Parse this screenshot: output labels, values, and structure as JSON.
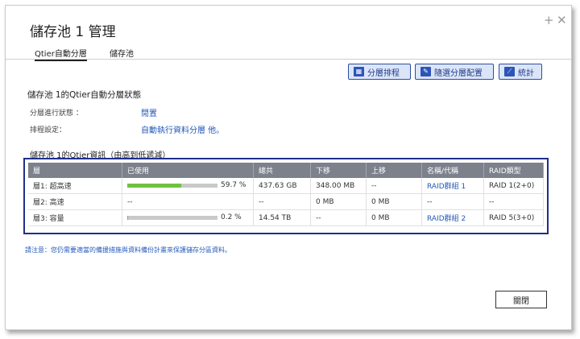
{
  "window": {
    "title": "儲存池 1 管理",
    "plus_icon": "+",
    "close_icon": "✕"
  },
  "tabs": [
    {
      "label": "Qtier自動分層"
    },
    {
      "label": "儲存池"
    }
  ],
  "toolbar": {
    "schedule_label": "分層排程",
    "config_label": "隨選分層配置",
    "stats_label": "統計"
  },
  "status_section": {
    "title": "儲存池 1的Qtier自動分層狀態",
    "progress_label": "分層進行狀態 ：",
    "progress_value": "閒置",
    "schedule_label": "排程設定：",
    "schedule_value": "自動執行資料分層 他。"
  },
  "table_section": {
    "title": "儲存池 1的Qtier資訊（由高到低遞減）",
    "headers": [
      "層",
      "已使用",
      "總共",
      "下移",
      "上移",
      "名稱/代稱",
      "RAID類型"
    ],
    "rows": [
      {
        "tier": "層1: 超高速",
        "used_pct": "59.7 %",
        "used_fraction": 0.597,
        "total": "437.63 GB",
        "down": "348.00 MB",
        "up": "--",
        "name": "RAID群組 1",
        "raid": "RAID 1(2+0)"
      },
      {
        "tier": "層2: 高速",
        "used_pct": "--",
        "used_fraction": null,
        "total": "--",
        "down": "0 MB",
        "up": "0 MB",
        "name": "--",
        "raid": "--"
      },
      {
        "tier": "層3: 容量",
        "used_pct": "0.2 %",
        "used_fraction": 0.002,
        "total": "14.54 TB",
        "down": "--",
        "up": "0 MB",
        "name": "RAID群組 2",
        "raid": "RAID 5(3+0)"
      }
    ]
  },
  "note": "請注意：您仍需要適當的備援措施與資料備份計畫來保護儲存分區資料。",
  "footer": {
    "close_label": "關閉"
  },
  "colors": {
    "accent": "#2458b8",
    "bar_fill": "#6fc23f",
    "table_border": "#1f2f8a"
  }
}
